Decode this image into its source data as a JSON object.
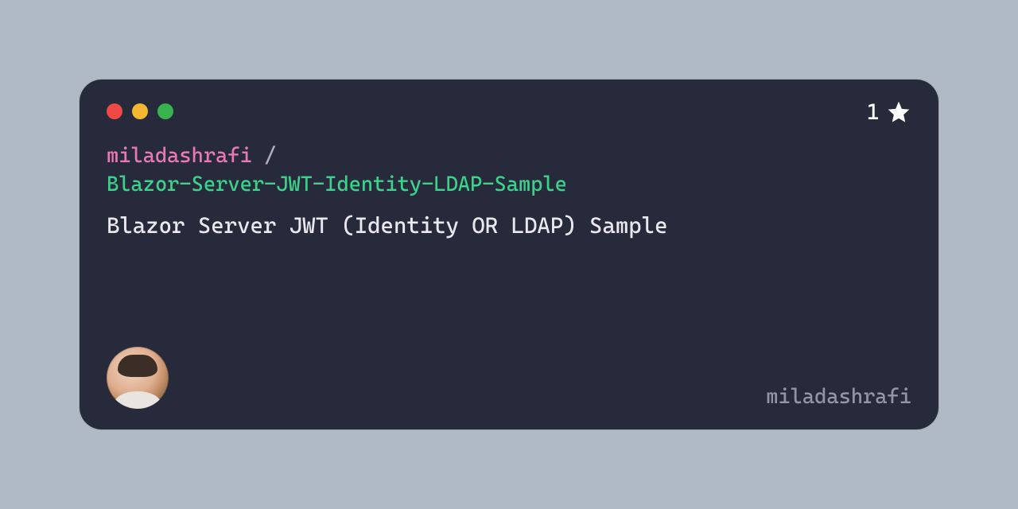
{
  "owner": "miladashrafi",
  "separator": " / ",
  "repo": "Blazor-Server-JWT-Identity-LDAP-Sample",
  "description": "Blazor Server JWT (Identity OR LDAP) Sample",
  "stars": "1",
  "username": "miladashrafi"
}
